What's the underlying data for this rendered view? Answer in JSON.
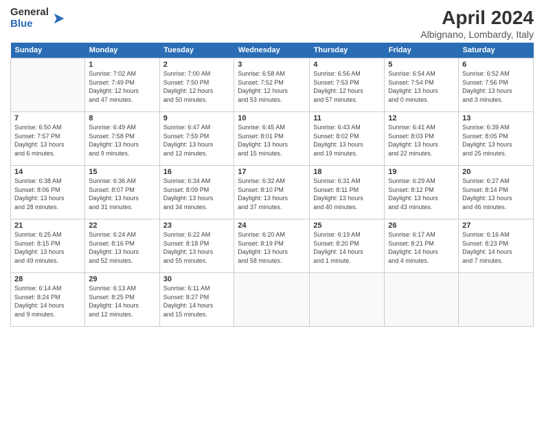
{
  "logo": {
    "general": "General",
    "blue": "Blue"
  },
  "title": "April 2024",
  "location": "Albignano, Lombardy, Italy",
  "days_of_week": [
    "Sunday",
    "Monday",
    "Tuesday",
    "Wednesday",
    "Thursday",
    "Friday",
    "Saturday"
  ],
  "weeks": [
    [
      {
        "day": "",
        "info": ""
      },
      {
        "day": "1",
        "info": "Sunrise: 7:02 AM\nSunset: 7:49 PM\nDaylight: 12 hours\nand 47 minutes."
      },
      {
        "day": "2",
        "info": "Sunrise: 7:00 AM\nSunset: 7:50 PM\nDaylight: 12 hours\nand 50 minutes."
      },
      {
        "day": "3",
        "info": "Sunrise: 6:58 AM\nSunset: 7:52 PM\nDaylight: 12 hours\nand 53 minutes."
      },
      {
        "day": "4",
        "info": "Sunrise: 6:56 AM\nSunset: 7:53 PM\nDaylight: 12 hours\nand 57 minutes."
      },
      {
        "day": "5",
        "info": "Sunrise: 6:54 AM\nSunset: 7:54 PM\nDaylight: 13 hours\nand 0 minutes."
      },
      {
        "day": "6",
        "info": "Sunrise: 6:52 AM\nSunset: 7:56 PM\nDaylight: 13 hours\nand 3 minutes."
      }
    ],
    [
      {
        "day": "7",
        "info": "Sunrise: 6:50 AM\nSunset: 7:57 PM\nDaylight: 13 hours\nand 6 minutes."
      },
      {
        "day": "8",
        "info": "Sunrise: 6:49 AM\nSunset: 7:58 PM\nDaylight: 13 hours\nand 9 minutes."
      },
      {
        "day": "9",
        "info": "Sunrise: 6:47 AM\nSunset: 7:59 PM\nDaylight: 13 hours\nand 12 minutes."
      },
      {
        "day": "10",
        "info": "Sunrise: 6:45 AM\nSunset: 8:01 PM\nDaylight: 13 hours\nand 15 minutes."
      },
      {
        "day": "11",
        "info": "Sunrise: 6:43 AM\nSunset: 8:02 PM\nDaylight: 13 hours\nand 19 minutes."
      },
      {
        "day": "12",
        "info": "Sunrise: 6:41 AM\nSunset: 8:03 PM\nDaylight: 13 hours\nand 22 minutes."
      },
      {
        "day": "13",
        "info": "Sunrise: 6:39 AM\nSunset: 8:05 PM\nDaylight: 13 hours\nand 25 minutes."
      }
    ],
    [
      {
        "day": "14",
        "info": "Sunrise: 6:38 AM\nSunset: 8:06 PM\nDaylight: 13 hours\nand 28 minutes."
      },
      {
        "day": "15",
        "info": "Sunrise: 6:36 AM\nSunset: 8:07 PM\nDaylight: 13 hours\nand 31 minutes."
      },
      {
        "day": "16",
        "info": "Sunrise: 6:34 AM\nSunset: 8:09 PM\nDaylight: 13 hours\nand 34 minutes."
      },
      {
        "day": "17",
        "info": "Sunrise: 6:32 AM\nSunset: 8:10 PM\nDaylight: 13 hours\nand 37 minutes."
      },
      {
        "day": "18",
        "info": "Sunrise: 6:31 AM\nSunset: 8:11 PM\nDaylight: 13 hours\nand 40 minutes."
      },
      {
        "day": "19",
        "info": "Sunrise: 6:29 AM\nSunset: 8:12 PM\nDaylight: 13 hours\nand 43 minutes."
      },
      {
        "day": "20",
        "info": "Sunrise: 6:27 AM\nSunset: 8:14 PM\nDaylight: 13 hours\nand 46 minutes."
      }
    ],
    [
      {
        "day": "21",
        "info": "Sunrise: 6:25 AM\nSunset: 8:15 PM\nDaylight: 13 hours\nand 49 minutes."
      },
      {
        "day": "22",
        "info": "Sunrise: 6:24 AM\nSunset: 8:16 PM\nDaylight: 13 hours\nand 52 minutes."
      },
      {
        "day": "23",
        "info": "Sunrise: 6:22 AM\nSunset: 8:18 PM\nDaylight: 13 hours\nand 55 minutes."
      },
      {
        "day": "24",
        "info": "Sunrise: 6:20 AM\nSunset: 8:19 PM\nDaylight: 13 hours\nand 58 minutes."
      },
      {
        "day": "25",
        "info": "Sunrise: 6:19 AM\nSunset: 8:20 PM\nDaylight: 14 hours\nand 1 minute."
      },
      {
        "day": "26",
        "info": "Sunrise: 6:17 AM\nSunset: 8:21 PM\nDaylight: 14 hours\nand 4 minutes."
      },
      {
        "day": "27",
        "info": "Sunrise: 6:16 AM\nSunset: 8:23 PM\nDaylight: 14 hours\nand 7 minutes."
      }
    ],
    [
      {
        "day": "28",
        "info": "Sunrise: 6:14 AM\nSunset: 8:24 PM\nDaylight: 14 hours\nand 9 minutes."
      },
      {
        "day": "29",
        "info": "Sunrise: 6:13 AM\nSunset: 8:25 PM\nDaylight: 14 hours\nand 12 minutes."
      },
      {
        "day": "30",
        "info": "Sunrise: 6:11 AM\nSunset: 8:27 PM\nDaylight: 14 hours\nand 15 minutes."
      },
      {
        "day": "",
        "info": ""
      },
      {
        "day": "",
        "info": ""
      },
      {
        "day": "",
        "info": ""
      },
      {
        "day": "",
        "info": ""
      }
    ]
  ]
}
